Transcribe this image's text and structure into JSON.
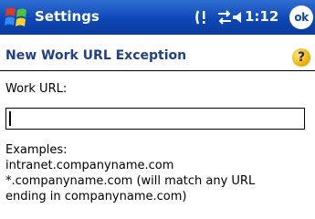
{
  "titlebar": {
    "app_title": "Settings",
    "time": "1:12",
    "ok_label": "ok",
    "icons": [
      "windows-start-icon",
      "notification-icon",
      "connectivity-icon",
      "volume-icon"
    ]
  },
  "page": {
    "title": "New Work URL Exception",
    "help_label": "?"
  },
  "form": {
    "url_label": "Work URL:",
    "url_value": ""
  },
  "examples": [
    "Examples:",
    "intranet.companyname.com",
    "*.companyname.com (will match any URL",
    "ending in companyname.com)"
  ],
  "colors": {
    "titlebar": "#0d47b8",
    "header_text": "#1f3f8f",
    "help_icon": "#f0b400"
  }
}
